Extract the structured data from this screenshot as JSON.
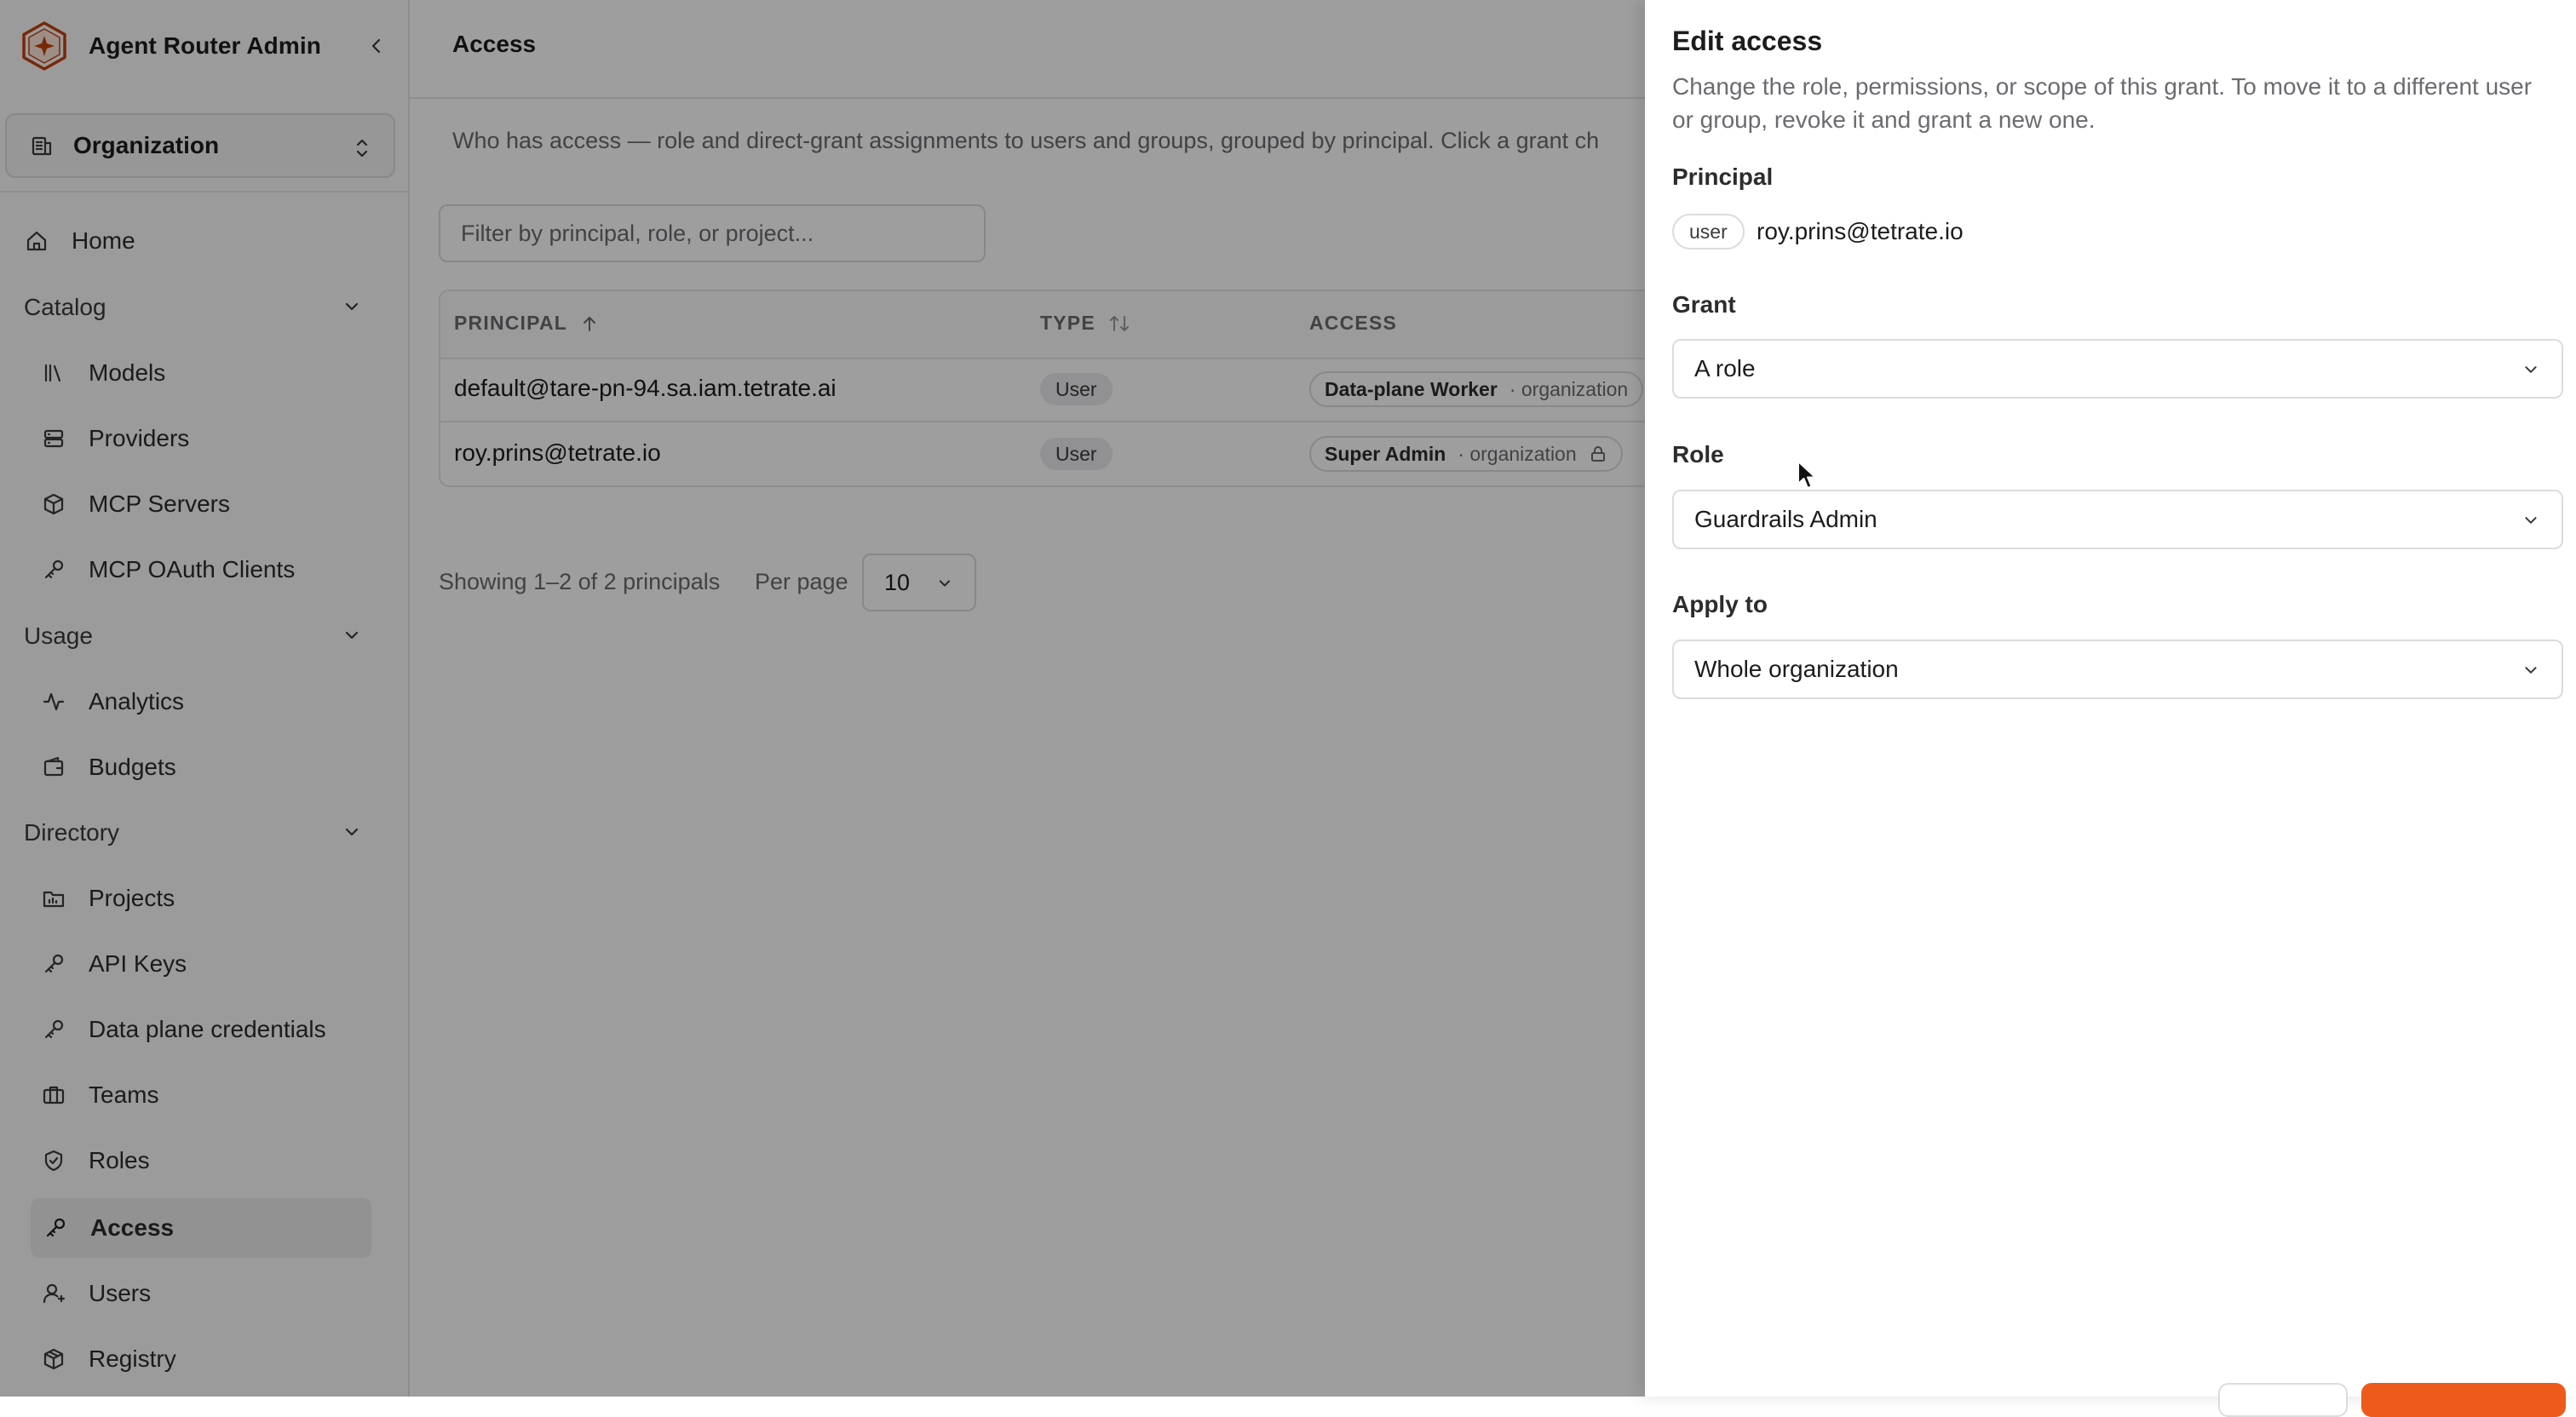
{
  "app": {
    "title": "Agent Router Admin"
  },
  "org_switcher": {
    "label": "Organization"
  },
  "sidebar": {
    "home": "Home",
    "catalog": {
      "label": "Catalog",
      "items": [
        "Models",
        "Providers",
        "MCP Servers",
        "MCP OAuth Clients"
      ]
    },
    "usage": {
      "label": "Usage",
      "items": [
        "Analytics",
        "Budgets"
      ]
    },
    "directory": {
      "label": "Directory",
      "items": [
        "Projects",
        "API Keys",
        "Data plane credentials",
        "Teams",
        "Roles",
        "Access",
        "Users",
        "Registry"
      ]
    },
    "active_item": "Access"
  },
  "page": {
    "title": "Access",
    "description": "Who has access — role and direct-grant assignments to users and groups, grouped by principal. Click a grant ch",
    "filter_placeholder": "Filter by principal, role, or project..."
  },
  "table": {
    "columns": [
      "PRINCIPAL",
      "TYPE",
      "ACCESS"
    ],
    "rows": [
      {
        "principal": "default@tare-pn-94.sa.iam.tetrate.ai",
        "type": "User",
        "role": "Data-plane Worker",
        "scope": "· organization"
      },
      {
        "principal": "roy.prins@tetrate.io",
        "type": "User",
        "role": "Super Admin",
        "scope": "· organization"
      }
    ]
  },
  "pagination": {
    "showing": "Showing 1–2 of 2 principals",
    "per_page_label": "Per page",
    "per_page_value": "10"
  },
  "drawer": {
    "title": "Edit access",
    "description": "Change the role, permissions, or scope of this grant. To move it to a different user or group, revoke it and grant a new one.",
    "principal_label": "Principal",
    "principal_type": "user",
    "principal_email": "roy.prins@tetrate.io",
    "grant_label": "Grant",
    "grant_value": "A role",
    "role_label": "Role",
    "role_value": "Guardrails Admin",
    "apply_label": "Apply to",
    "apply_value": "Whole organization"
  },
  "colors": {
    "accent": "#ee5a1c",
    "logo": "#c2410c",
    "overlay": "rgba(0,0,0,0.38)"
  },
  "icons": [
    "hexagon-logo-icon",
    "chevron-left-icon",
    "building-icon",
    "chevrons-up-down-icon",
    "home-icon",
    "library-icon",
    "server-icon",
    "box-icon",
    "key-icon",
    "activity-icon",
    "wallet-icon",
    "folder-icon",
    "briefcase-icon",
    "shield-icon",
    "user-icon",
    "package-icon",
    "arrow-up-icon",
    "sort-icon",
    "lock-icon",
    "chevron-down-icon",
    "cursor-icon"
  ]
}
